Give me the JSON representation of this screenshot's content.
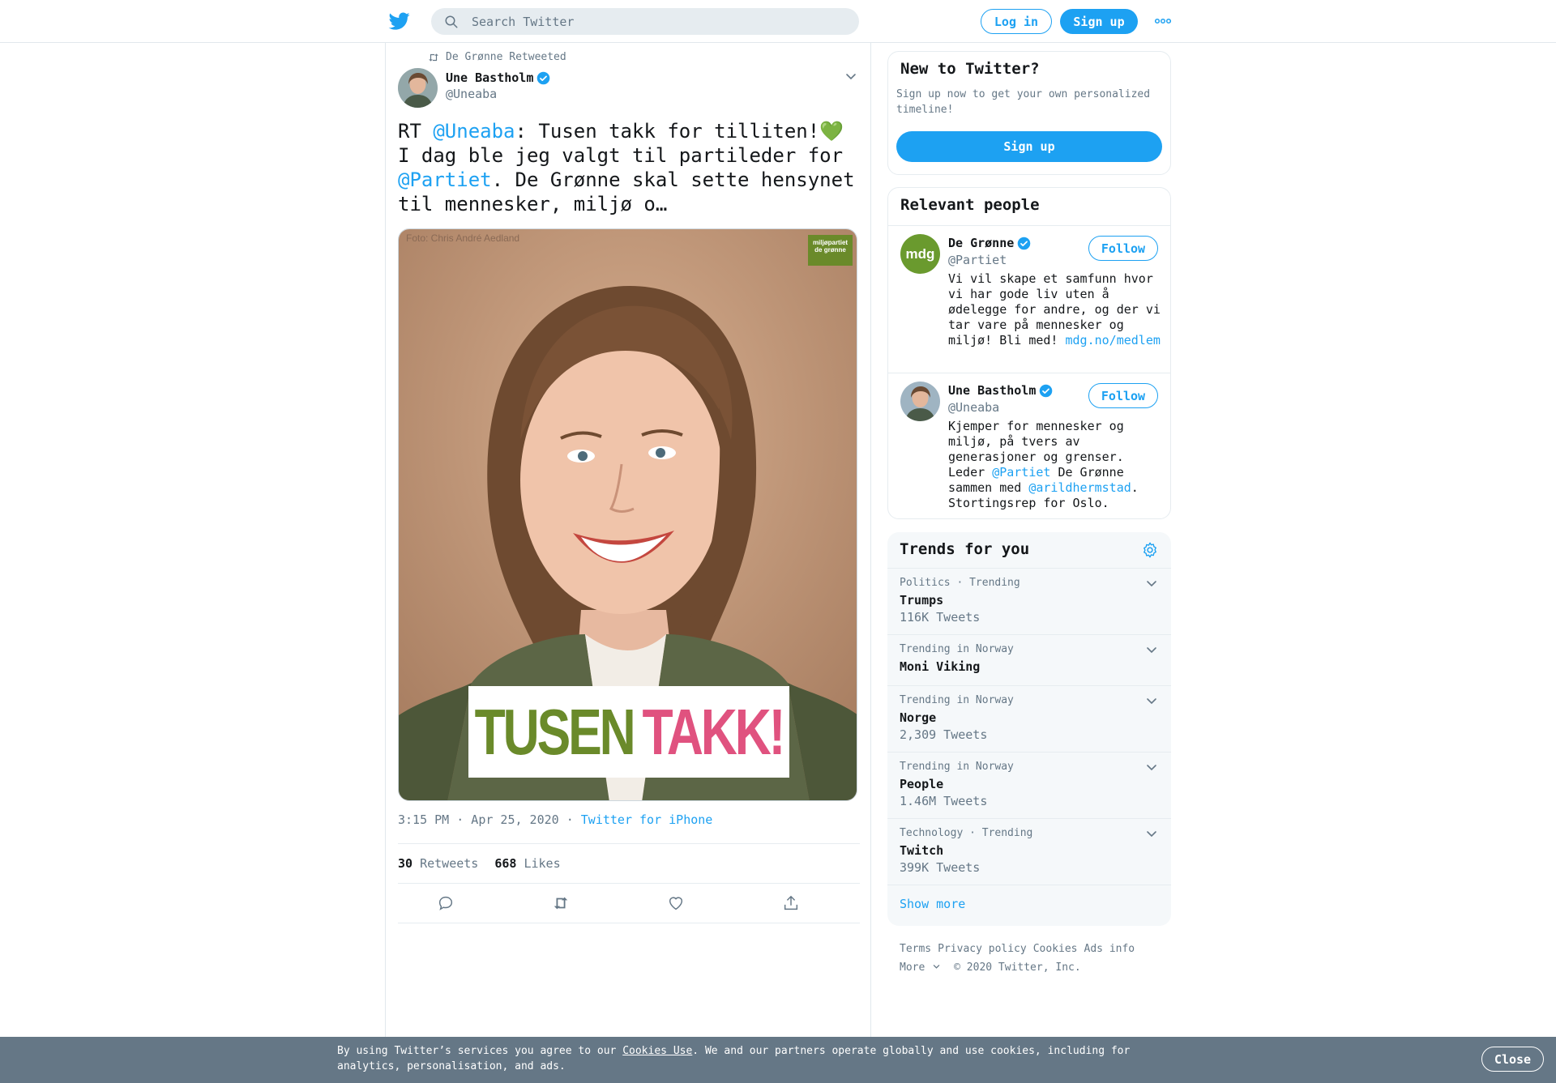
{
  "header": {
    "search_placeholder": "Search Twitter",
    "login_label": "Log in",
    "signup_label": "Sign up"
  },
  "tweet": {
    "retweeted_by": "De Grønne Retweeted",
    "author_name": "Une Bastholm",
    "author_handle": "@Uneaba",
    "text_parts": {
      "p1": "RT ",
      "m1": "@Uneaba",
      "p2": ": Tusen takk for tilliten!",
      "heart": "💚",
      "p3": " I dag ble jeg valgt til partileder for ",
      "m2": "@Partiet",
      "p4": ". De Grønne skal sette hensynet til mennesker, miljø o…"
    },
    "image": {
      "photo_credit": "Foto: Chris André Aedland",
      "logo_line1": "miljøpartiet",
      "logo_line2": "de grønne",
      "banner_word1": "TUSEN",
      "banner_word2": "TAKK!"
    },
    "timestamp": "3:15 PM · Apr 25, 2020",
    "separator": " · ",
    "source": "Twitter for iPhone",
    "retweets_count": "30",
    "retweets_label": "Retweets",
    "likes_count": "668",
    "likes_label": "Likes"
  },
  "new_to_twitter": {
    "title": "New to Twitter?",
    "subtitle": "Sign up now to get your own personalized timeline!",
    "signup_label": "Sign up"
  },
  "relevant_people": {
    "title": "Relevant people",
    "people": [
      {
        "name": "De Grønne",
        "handle": "@Partiet",
        "avatar_text": "mdg",
        "follow_label": "Follow",
        "bio_text": "Vi vil skape et samfunn hvor vi har gode liv uten å ødelegge for andre, og der vi tar vare på mennesker og miljø! Bli med!",
        "bio_link": "mdg.no/medlem"
      },
      {
        "name": "Une Bastholm",
        "handle": "@Uneaba",
        "follow_label": "Follow",
        "bio_a": "Kjemper for mennesker og miljø, på tvers av generasjoner og grenser. Leder ",
        "bio_m1": "@Partiet",
        "bio_b": " De Grønne sammen med ",
        "bio_m2": "@arildhermstad",
        "bio_c": ". Stortingsrep for Oslo."
      }
    ]
  },
  "trends": {
    "title": "Trends for you",
    "items": [
      {
        "context": "Politics · Trending",
        "name": "Trumps",
        "count": "116K Tweets"
      },
      {
        "context": "Trending in Norway",
        "name": "Moni Viking",
        "count": ""
      },
      {
        "context": "Trending in Norway",
        "name": "Norge",
        "count": "2,309 Tweets"
      },
      {
        "context": "Trending in Norway",
        "name": "People",
        "count": "1.46M Tweets"
      },
      {
        "context": "Technology · Trending",
        "name": "Twitch",
        "count": "399K Tweets"
      }
    ],
    "show_more": "Show more"
  },
  "footer": {
    "links": [
      "Terms",
      "Privacy policy",
      "Cookies",
      "Ads info"
    ],
    "more": "More",
    "copyright": "© 2020 Twitter, Inc."
  },
  "cookie_banner": {
    "text_before": "By using Twitter’s services you agree to our ",
    "link": "Cookies Use",
    "text_after": ". We and our partners operate globally and use cookies, including for analytics, personalisation, and ads.",
    "close_label": "Close"
  },
  "colors": {
    "accent": "#1da1f2",
    "mdg_green": "#6a8a2a",
    "takk_pink": "#e0527f",
    "cookie_bg": "#657786"
  }
}
